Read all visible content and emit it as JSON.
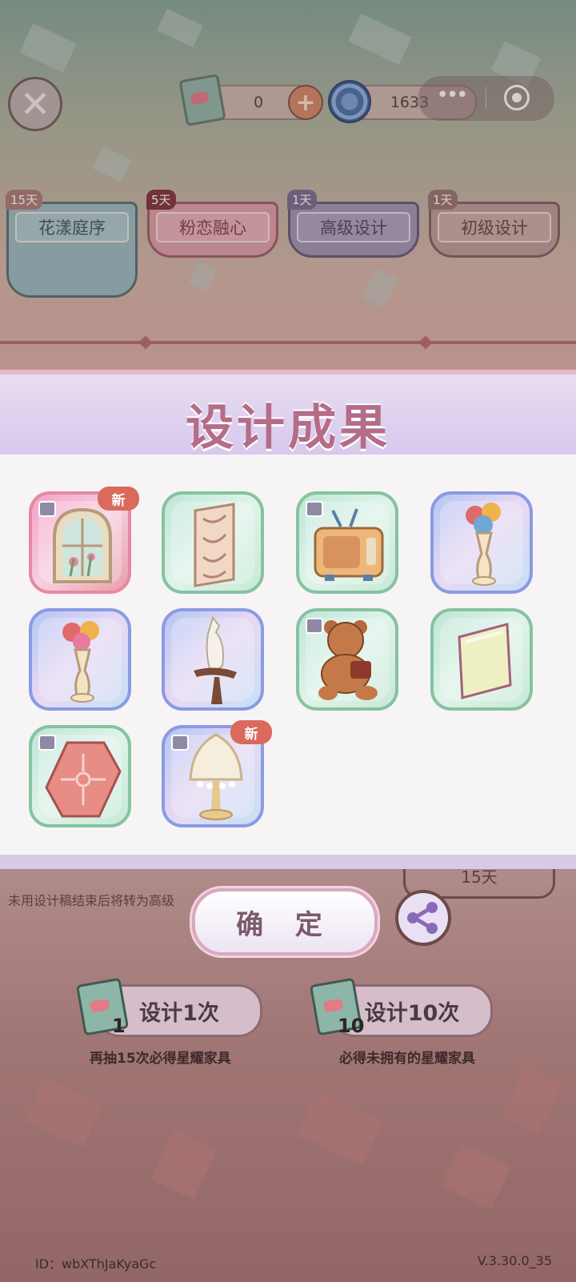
{
  "topbar": {
    "ticket_count": "0",
    "orb_count": "1633",
    "icons": [
      "close-icon",
      "ticket-icon",
      "plus-icon",
      "orb-icon",
      "more-dots-icon",
      "target-icon"
    ]
  },
  "tabs": [
    {
      "label": "花漾庭序",
      "badge": "15天"
    },
    {
      "label": "粉恋融心",
      "badge": "5天"
    },
    {
      "label": "高级设计",
      "badge": "1天"
    },
    {
      "label": "初级设计",
      "badge": "1天"
    }
  ],
  "result": {
    "title": "设计成果",
    "new_label": "新",
    "items": [
      {
        "name": "stained-glass-window",
        "rarity": "pink",
        "is_new": true,
        "icon": "arched-window-icon"
      },
      {
        "name": "carved-screen-panel",
        "rarity": "green",
        "is_new": false,
        "icon": "screen-panel-icon"
      },
      {
        "name": "retro-tv",
        "rarity": "green",
        "is_new": false,
        "icon": "tv-icon"
      },
      {
        "name": "flower-vase-blue",
        "rarity": "blue",
        "is_new": false,
        "icon": "vase-icon"
      },
      {
        "name": "flower-vase-blue-2",
        "rarity": "blue",
        "is_new": false,
        "icon": "vase-icon"
      },
      {
        "name": "cockatoo-perch",
        "rarity": "blue",
        "is_new": false,
        "icon": "bird-icon"
      },
      {
        "name": "teddy-bear",
        "rarity": "green",
        "is_new": false,
        "icon": "bear-icon"
      },
      {
        "name": "glass-panel",
        "rarity": "green",
        "is_new": false,
        "icon": "glass-icon"
      },
      {
        "name": "rose-tray",
        "rarity": "green",
        "is_new": false,
        "icon": "tray-icon"
      },
      {
        "name": "pearl-lamp",
        "rarity": "blue",
        "is_new": true,
        "icon": "lamp-icon"
      }
    ]
  },
  "footer": {
    "tip": "未用设计稿结束后将转为高级",
    "days": "15天",
    "confirm_label": "确 定",
    "draw_once": {
      "label": "设计1次",
      "count": "1",
      "note": "再抽15次必得星耀家具"
    },
    "draw_ten": {
      "label": "设计10次",
      "count": "10",
      "note": "必得未拥有的星耀家具"
    },
    "user_id": "ID：wbXThJaKyaGc",
    "version": "V.3.30.0_35"
  },
  "colors": {
    "title": "#b46d89",
    "panel": "#f7f4f6",
    "accent_line": "#b56a6a"
  }
}
